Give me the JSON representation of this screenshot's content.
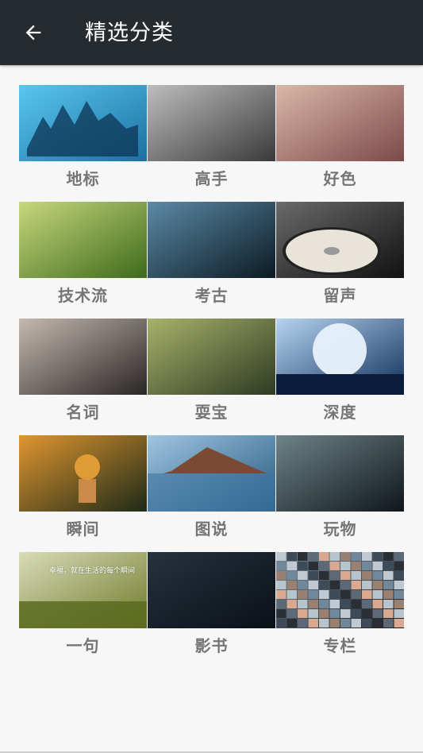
{
  "header": {
    "title": "精选分类",
    "back_icon": "arrow-left-icon"
  },
  "categories": [
    {
      "label": "地标",
      "image": "castle-at-night-image",
      "colors": [
        "#1c6fa3",
        "#58c7ef"
      ]
    },
    {
      "label": "高手",
      "image": "anime-swordsman-image",
      "colors": [
        "#3a3a3a",
        "#bdbdbd"
      ]
    },
    {
      "label": "好色",
      "image": "woman-on-bed-image",
      "colors": [
        "#7c4a49",
        "#d9b7a8"
      ]
    },
    {
      "label": "技术流",
      "image": "vr-headset-image",
      "colors": [
        "#3d6b1c",
        "#c8d77b"
      ]
    },
    {
      "label": "考古",
      "image": "tomb-explorers-image",
      "colors": [
        "#0b1a24",
        "#5c8aa6"
      ]
    },
    {
      "label": "留声",
      "image": "vinyl-record-image",
      "colors": [
        "#111111",
        "#6a6a6a"
      ]
    },
    {
      "label": "名词",
      "image": "parasyte-poster-image",
      "colors": [
        "#2a2626",
        "#c4b9b0"
      ]
    },
    {
      "label": "耍宝",
      "image": "cartoon-characters-image",
      "colors": [
        "#2f3a23",
        "#a7b26a"
      ]
    },
    {
      "label": "深度",
      "image": "lion-king-moon-image",
      "colors": [
        "#0f2e5a",
        "#b6d4f0"
      ]
    },
    {
      "label": "瞬间",
      "image": "splash-figure-image",
      "colors": [
        "#1d2a18",
        "#e0962f"
      ]
    },
    {
      "label": "图说",
      "image": "frozen-lake-image",
      "colors": [
        "#25577e",
        "#9ec6e0"
      ]
    },
    {
      "label": "玩物",
      "image": "dark-forest-image",
      "colors": [
        "#10161a",
        "#6d8488"
      ]
    },
    {
      "label": "一句",
      "image": "moss-quote-image",
      "colors": [
        "#6f7a2a",
        "#d8dcb8"
      ],
      "caption": "幸福，就在生活的每个瞬间"
    },
    {
      "label": "影书",
      "image": "night-city-image",
      "colors": [
        "#0a1018",
        "#26323d"
      ]
    },
    {
      "label": "专栏",
      "image": "mosaic-collage-image",
      "colors": [
        "#1a1a1a",
        "#7a8a99"
      ]
    }
  ]
}
